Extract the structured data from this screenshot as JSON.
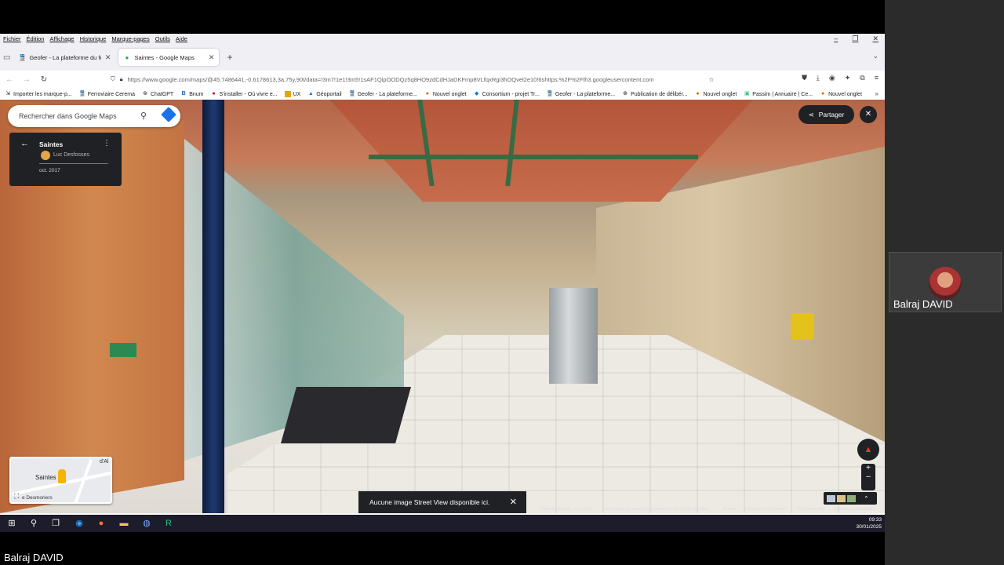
{
  "meeting": {
    "participant_tile_name": "Balraj DAVID",
    "bottom_name": "Balraj DAVID"
  },
  "browser": {
    "menu": [
      "Fichier",
      "Édition",
      "Affichage",
      "Historique",
      "Marque-pages",
      "Outils",
      "Aide"
    ],
    "tabs": [
      {
        "label": "Geofer - La plateforme du ferroviaire",
        "active": false
      },
      {
        "label": "Saintes - Google Maps",
        "active": true
      }
    ],
    "url": "https://www.google.com/maps/@45.7486441,-0.6178613,3a,75y,90t/data=!3m7!1e1!3m5!1sAF1QipOODQz5q8HO9zdCdHJaDKFmp8VLfqxRgi3hOQvel2e10!6shttps:%2F%2Flh3.googleusercontent.com",
    "bookmarks": [
      {
        "label": "Importer les marque-p...",
        "icon": "import-icon"
      },
      {
        "label": "Ferroviaire Cerema",
        "icon": "train-icon"
      },
      {
        "label": "ChatGPT",
        "icon": "chatgpt-icon"
      },
      {
        "label": "Bnum",
        "icon": "b-icon"
      },
      {
        "label": "S'installer - Où vivre e...",
        "icon": "pin-icon"
      },
      {
        "label": "UX",
        "icon": "ux-icon"
      },
      {
        "label": "Géoportail",
        "icon": "geoportail-icon"
      },
      {
        "label": "Geofer - La plateforme...",
        "icon": "train-icon"
      },
      {
        "label": "Nouvel onglet",
        "icon": "tab-icon"
      },
      {
        "label": "Consortium - projet Tr...",
        "icon": "consortium-icon"
      },
      {
        "label": "Geofer - La plateforme...",
        "icon": "train-icon"
      },
      {
        "label": "Publication de délibér...",
        "icon": "globe-icon"
      },
      {
        "label": "Nouvel onglet",
        "icon": "tab-icon"
      },
      {
        "label": "Passim | Annuaire | Ce...",
        "icon": "passim-icon"
      },
      {
        "label": "Nouvel onglet",
        "icon": "tab-icon"
      }
    ]
  },
  "maps": {
    "search_placeholder": "Rechercher dans Google Maps",
    "card": {
      "title": "Saintes",
      "author": "Luc Desfosses",
      "date": "oct. 2017"
    },
    "share_label": "Partager",
    "minimap": {
      "label": "Saintes",
      "street": "e Desmoriers",
      "top_label": "d'Al"
    },
    "toast": "Aucune image Street View disponible ici.",
    "attribution": {
      "image_date": "Date de l'image : oct. 2017",
      "rights": "Les images peuvent être soumises à des droits d'auteur.",
      "country": "France",
      "terms": "Conditions d'utilisation",
      "privacy": "Confidentialité",
      "report": "Signaler un problème"
    }
  },
  "taskbar": {
    "time": "09:33",
    "date": "30/01/2025"
  },
  "colors": {
    "accent": "#1a73e8",
    "dark_panel": "#202124",
    "taskbar": "#1c1c2a"
  }
}
